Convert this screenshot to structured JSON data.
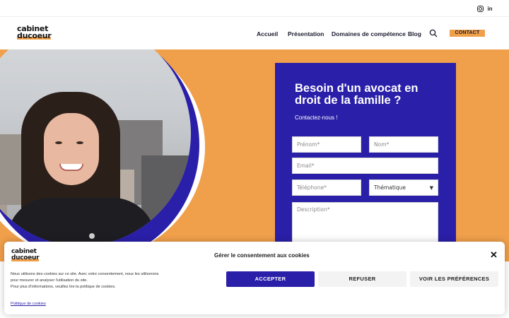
{
  "header": {
    "logo_line1": "cabinet",
    "logo_line2": "ducoeur",
    "nav": [
      "Accueil",
      "Présentation",
      "Domaines de compétence",
      "Blog"
    ],
    "contact_label": "CONTACT",
    "social": {
      "instagram": "instagram-icon",
      "linkedin_text": "in"
    }
  },
  "hero": {
    "form_title": "Besoin d'un avocat en droit de la famille ?",
    "form_subtitle": "Contactez-nous !",
    "fields": {
      "prenom": "Prénom*",
      "nom": "Nom*",
      "email": "Email*",
      "telephone": "Téléphone*",
      "thematique": "Thématique",
      "description": "Description*"
    }
  },
  "cookie_banner": {
    "logo_line1": "cabinet",
    "logo_line2": "ducoeur",
    "title": "Gérer le consentement aux cookies",
    "text_lines": [
      "Nous utilisons des cookies sur ce site. Avec votre consentement, nous les utiliserons",
      "pour mesurer et analyser l'utilisation du site.",
      "Pour plus d'informations, veuillez lire la politique de cookies."
    ],
    "policy_link": "Politique de cookies",
    "accept_label": "ACCEPTER",
    "refuse_label": "REFUSER",
    "prefs_label": "VOIR LES PRÉFÉRENCES",
    "close_label": "✕"
  },
  "colors": {
    "brand_blue": "#2a1fa8",
    "brand_orange": "#f0a04b"
  }
}
